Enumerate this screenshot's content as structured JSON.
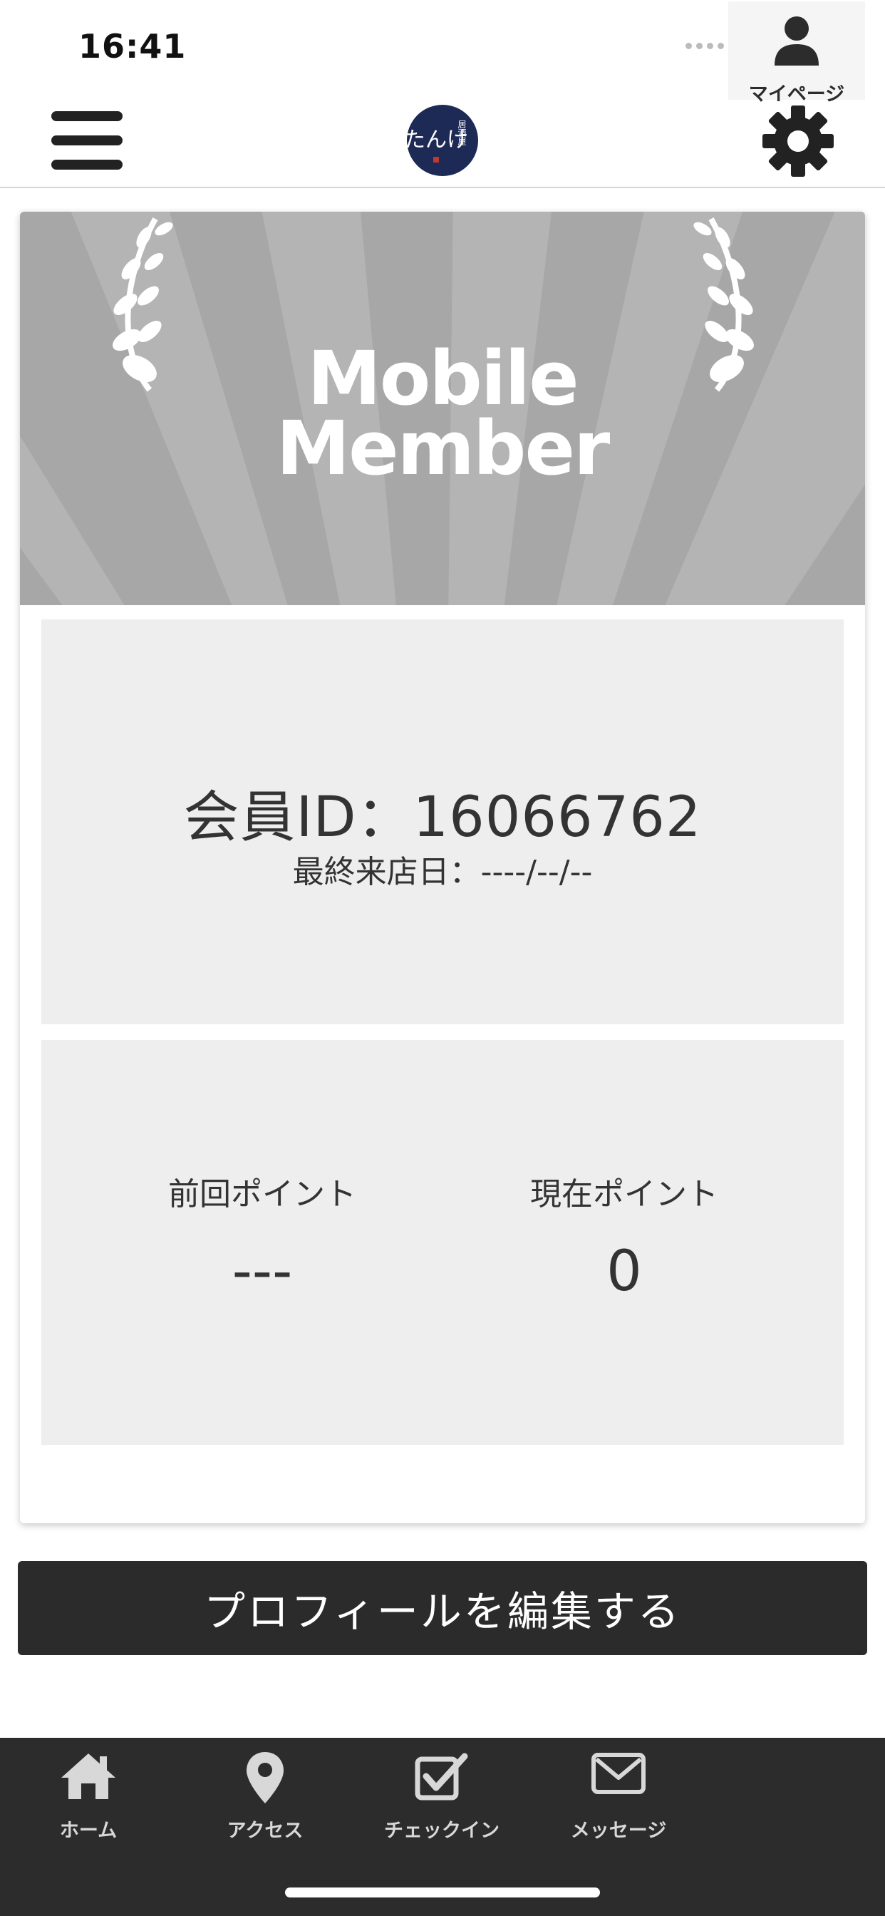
{
  "status_bar": {
    "time": "16:41"
  },
  "header": {
    "logo_name": "たんけ",
    "logo_subtitle": "居酒屋"
  },
  "banner": {
    "line1": "Mobile",
    "line2": "Member"
  },
  "member": {
    "id_text": "会員ID：16066762",
    "last_visit_text": "最終来店日：----/--/--"
  },
  "points": {
    "previous_label": "前回ポイント",
    "previous_value": "---",
    "current_label": "現在ポイント",
    "current_value": "0"
  },
  "edit_profile_label": "プロフィールを編集する",
  "tabs": [
    {
      "label": "ホーム",
      "icon": "home-icon"
    },
    {
      "label": "アクセス",
      "icon": "map-pin-icon"
    },
    {
      "label": "チェックイン",
      "icon": "checkin-icon"
    },
    {
      "label": "メッセージ",
      "icon": "mail-icon"
    },
    {
      "label": "マイページ",
      "icon": "user-icon",
      "active": true
    }
  ],
  "colors": {
    "header_text": "#222222",
    "tab_bar": "#2c2c2c",
    "button": "#2b2b2b",
    "panel": "#eeeeee",
    "banner": "#a8a8a8"
  }
}
